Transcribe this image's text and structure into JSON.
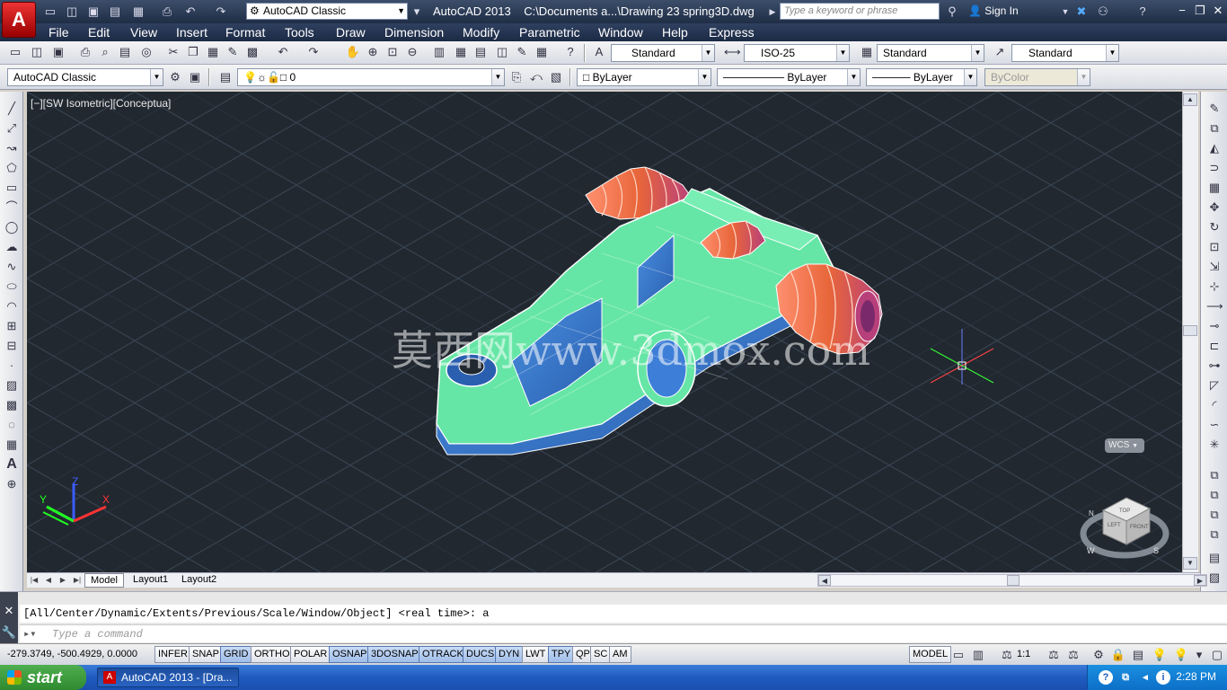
{
  "app_button": {
    "label": "A"
  },
  "quick_access": {
    "workspace": "AutoCAD Classic"
  },
  "title": {
    "app": "AutoCAD 2013",
    "document": "C:\\Documents a...\\Drawing 23 spring3D.dwg"
  },
  "search": {
    "placeholder": "Type a keyword or phrase"
  },
  "sign_in": {
    "label": "Sign In"
  },
  "menu": [
    "File",
    "Edit",
    "View",
    "Insert",
    "Format",
    "Tools",
    "Draw",
    "Dimension",
    "Modify",
    "Parametric",
    "Window",
    "Help",
    "Express"
  ],
  "styles": {
    "text_style": "Standard",
    "dim_style": "ISO-25",
    "table_style": "Standard",
    "multileader_style": "Standard"
  },
  "workspace_combo": {
    "value": "AutoCAD Classic"
  },
  "layer_combo": {
    "value": "0"
  },
  "properties": {
    "color": "ByLayer",
    "linetype": "ByLayer",
    "lineweight": "ByLayer",
    "plot_style": "ByColor"
  },
  "viewport": {
    "label": "[−][SW Isometric][Conceptua]",
    "watermark": "莫西网www.3dmox.com",
    "wcs": "WCS",
    "axis_x": "X",
    "axis_y": "Y",
    "axis_z": "Z",
    "viewcube_top": "TOP",
    "viewcube_front": "FRONT",
    "viewcube_left": "LEFT",
    "compass_w": "W",
    "compass_s": "S",
    "compass_n": "N"
  },
  "layout_tabs": [
    "Model",
    "Layout1",
    "Layout2"
  ],
  "command": {
    "history": "[All/Center/Dynamic/Extents/Previous/Scale/Window/Object] <real time>: a",
    "placeholder": "Type a command"
  },
  "status": {
    "coords": "-279.3749, -500.4929, 0.0000",
    "toggles": [
      "INFER",
      "SNAP",
      "GRID",
      "ORTHO",
      "POLAR",
      "OSNAP",
      "3DOSNAP",
      "OTRACK",
      "DUCS",
      "DYN",
      "LWT",
      "TPY",
      "QP",
      "SC",
      "AM"
    ],
    "model": "MODEL",
    "scale": "1:1"
  },
  "taskbar": {
    "start": "start",
    "task": "AutoCAD 2013 - [Dra...",
    "time": "2:28 PM"
  },
  "colors": {
    "viewport_bg": "#212830",
    "part_green": "#66e6a6",
    "part_blue": "#3d7ed8",
    "spring_orange": "#e8663a"
  }
}
